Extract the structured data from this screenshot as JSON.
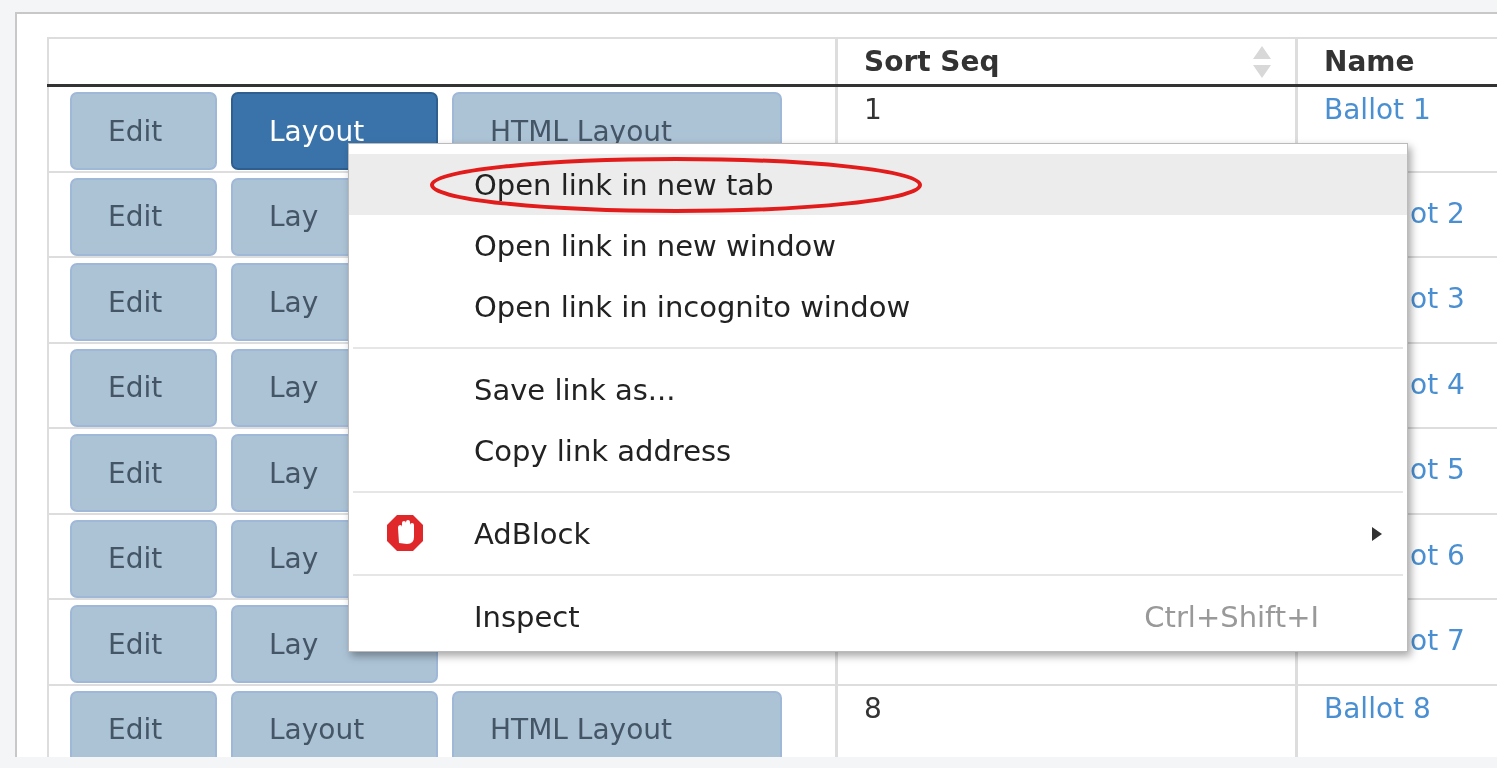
{
  "table": {
    "columns": [
      {
        "label": "Sort Seq",
        "sortable": true
      },
      {
        "label": "Name"
      }
    ],
    "rows": [
      {
        "obscured": false,
        "actions": [
          {
            "label": "Edit",
            "selected": false
          },
          {
            "label": "Layout",
            "selected": true
          },
          {
            "label": "HTML Layout",
            "selected": false
          }
        ],
        "sort_seq": "1",
        "name": "Ballot 1"
      },
      {
        "obscured": true,
        "actions": [
          {
            "label": "Edit",
            "selected": false
          },
          {
            "label": "Lay",
            "selected": false
          }
        ],
        "name": "ot 2"
      },
      {
        "obscured": true,
        "actions": [
          {
            "label": "Edit",
            "selected": false
          },
          {
            "label": "Lay",
            "selected": false
          }
        ],
        "name": "ot 3"
      },
      {
        "obscured": true,
        "actions": [
          {
            "label": "Edit",
            "selected": false
          },
          {
            "label": "Lay",
            "selected": false
          }
        ],
        "name": "ot 4"
      },
      {
        "obscured": true,
        "actions": [
          {
            "label": "Edit",
            "selected": false
          },
          {
            "label": "Lay",
            "selected": false
          }
        ],
        "name": "ot 5"
      },
      {
        "obscured": true,
        "actions": [
          {
            "label": "Edit",
            "selected": false
          },
          {
            "label": "Lay",
            "selected": false
          }
        ],
        "name": "ot 6"
      },
      {
        "obscured": true,
        "actions": [
          {
            "label": "Edit",
            "selected": false
          },
          {
            "label": "Lay",
            "selected": false
          }
        ],
        "name": "ot 7"
      },
      {
        "obscured": false,
        "actions": [
          {
            "label": "Edit",
            "selected": false
          },
          {
            "label": "Layout",
            "selected": false
          },
          {
            "label": "HTML Layout",
            "selected": false
          }
        ],
        "sort_seq": "8",
        "name": "Ballot 8"
      }
    ]
  },
  "context_menu": {
    "items": [
      {
        "kind": "item",
        "label": "Open link in new tab",
        "selected": true,
        "circled": true
      },
      {
        "kind": "item",
        "label": "Open link in new window",
        "selected": false,
        "circled": false
      },
      {
        "kind": "item",
        "label": "Open link in incognito window",
        "selected": false,
        "circled": false
      },
      {
        "kind": "separator"
      },
      {
        "kind": "item",
        "label": "Save link as...",
        "selected": false,
        "circled": false
      },
      {
        "kind": "item",
        "label": "Copy link address",
        "selected": false,
        "circled": false
      },
      {
        "kind": "separator"
      },
      {
        "kind": "extension",
        "label": "AdBlock",
        "selected": false,
        "circled": false
      },
      {
        "kind": "separator"
      },
      {
        "kind": "item",
        "label": "Inspect",
        "shortcut": "Ctrl+Shift+I",
        "selected": false,
        "circled": false
      }
    ]
  }
}
